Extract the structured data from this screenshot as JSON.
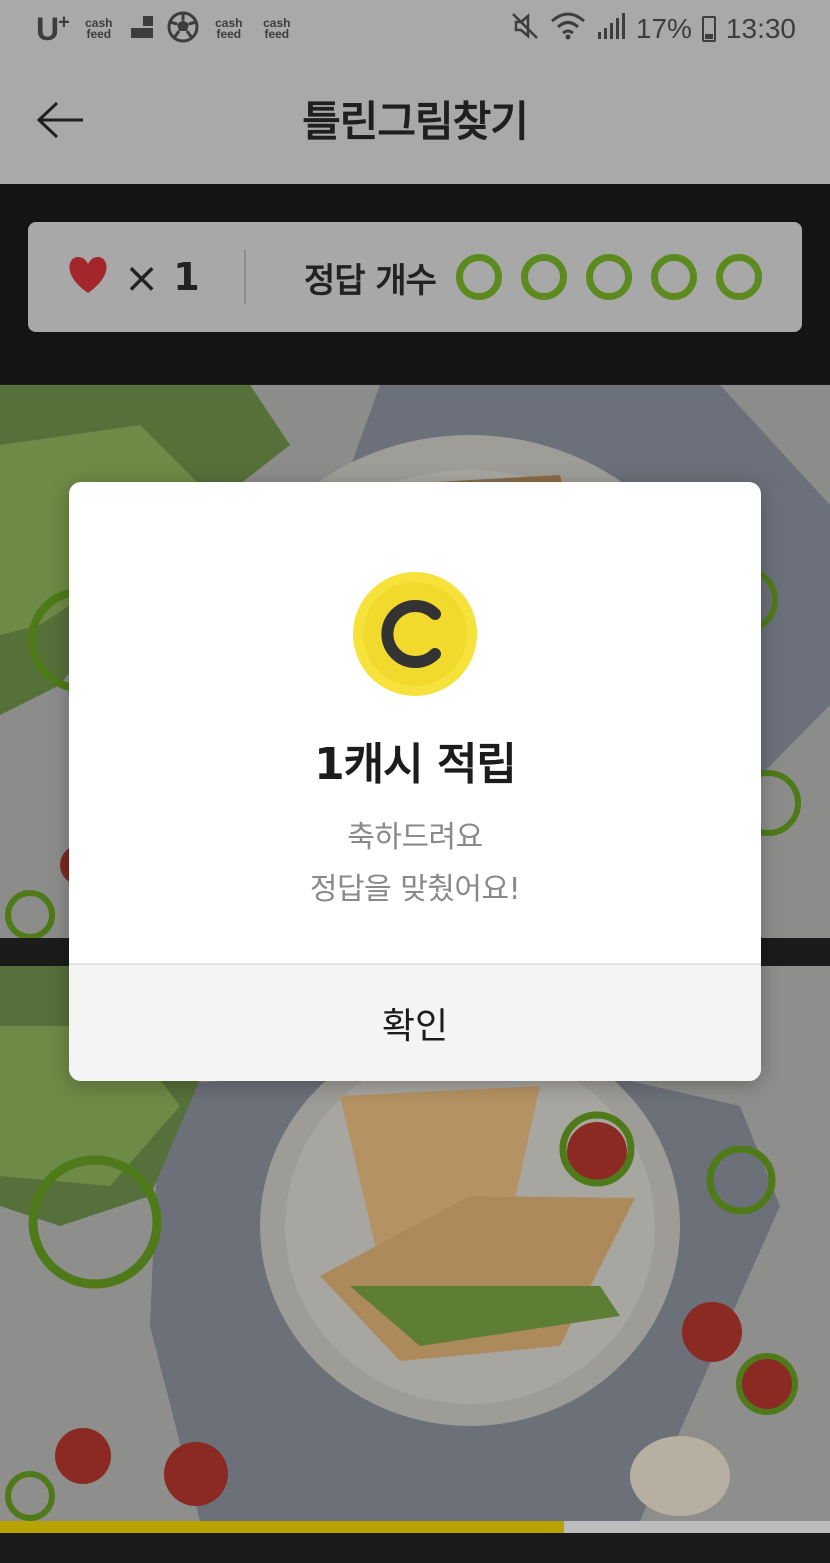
{
  "status_bar": {
    "carrier": "U",
    "notification_labels": [
      "cash feed",
      "cash feed",
      "cash feed"
    ],
    "battery": "17%",
    "time": "13:30",
    "icons": [
      "mute-icon",
      "wifi-icon",
      "signal-icon",
      "battery-icon"
    ]
  },
  "header": {
    "title": "틀린그림찾기",
    "back_icon": "arrow-left-icon"
  },
  "game_status": {
    "lives_icon": "heart-icon",
    "lives_multiplier": "×",
    "lives": "1",
    "answers_label": "정답 개수",
    "answer_slots_total": 5
  },
  "progress": {
    "fraction": 0.68,
    "color": "#b8a300"
  },
  "colors": {
    "accent_green": "#5c8a1f",
    "heart_red": "#c0282f",
    "coin_yellow": "#f5e03a"
  },
  "dialog": {
    "coin_letter": "C",
    "title": "1캐시 적립",
    "message_line1": "축하드려요",
    "message_line2": "정답을 맞췄어요!",
    "confirm_label": "확인"
  }
}
